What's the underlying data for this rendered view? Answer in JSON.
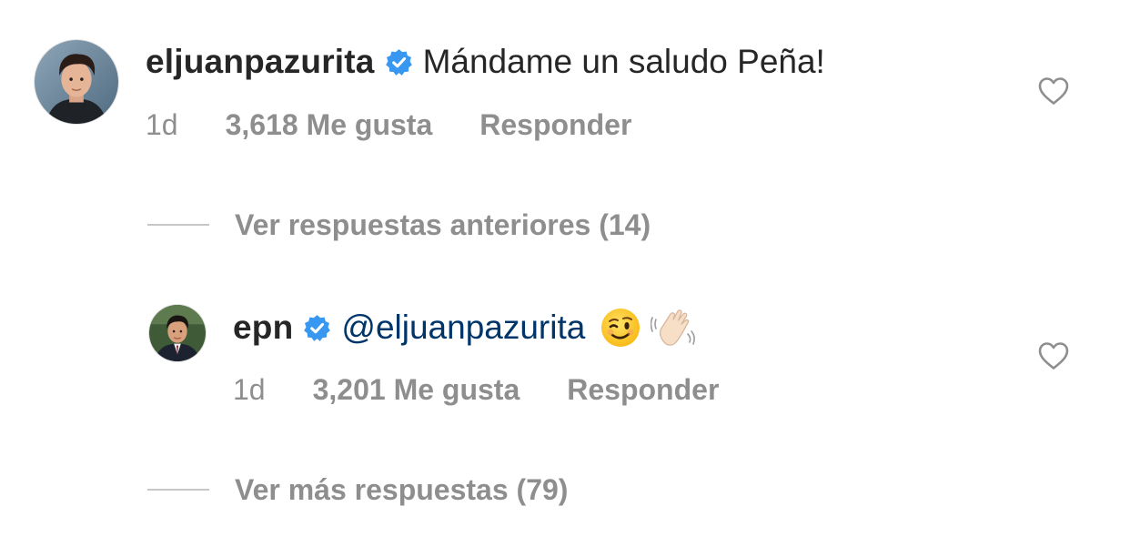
{
  "comment": {
    "username": "eljuanpazurita",
    "text": "Mándame un saludo Peña!",
    "time": "1d",
    "likes": "3,618 Me gusta",
    "reply_label": "Responder",
    "verified": true
  },
  "previous_replies": {
    "label": "Ver respuestas anteriores (14)"
  },
  "reply": {
    "username": "epn",
    "mention": "@eljuanpazurita",
    "emojis": [
      "winking-face",
      "waving-hand"
    ],
    "time": "1d",
    "likes": "3,201 Me gusta",
    "reply_label": "Responder",
    "verified": true
  },
  "more_replies": {
    "label": "Ver más respuestas (79)"
  },
  "colors": {
    "text": "#262626",
    "secondary": "#8e8e8e",
    "mention": "#003569",
    "verified_badge": "#3897f0",
    "divider": "#c7c7c7"
  }
}
